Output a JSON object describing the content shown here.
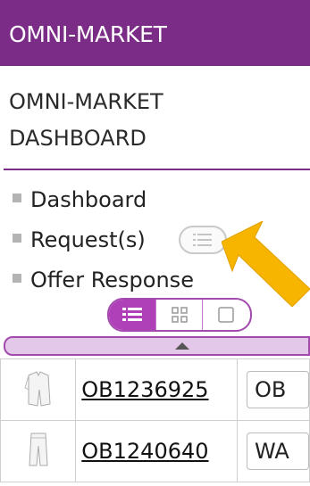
{
  "header": {
    "title": "OMNI-MARKET"
  },
  "dashboard": {
    "title_line1": "OMNI-MARKET",
    "title_line2": "DASHBOARD"
  },
  "nav": {
    "items": [
      {
        "label": "Dashboard"
      },
      {
        "label": "Request(s)"
      },
      {
        "label": "Offer Response"
      }
    ]
  },
  "view_toggle": {
    "options": [
      "list-view-icon",
      "grid-view-icon",
      "single-view-icon"
    ],
    "active": "list-view-icon"
  },
  "orders": [
    {
      "id": "OB1236925",
      "type": "OB",
      "thumbnail": "garment-icon"
    },
    {
      "id": "OB1240640",
      "type": "WA",
      "thumbnail": "garment-icon"
    }
  ],
  "colors": {
    "brand": "#7b2c86",
    "accent": "#b040b8",
    "arrow": "#f7b500"
  }
}
